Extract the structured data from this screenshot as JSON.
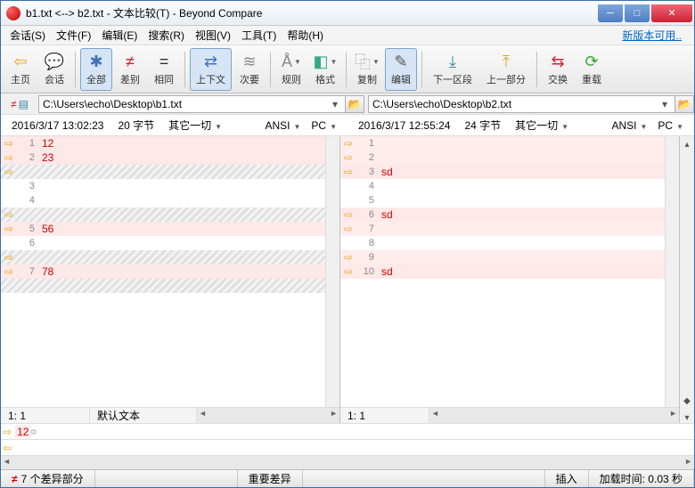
{
  "title": "b1.txt <--> b2.txt - 文本比较(T) - Beyond Compare",
  "menus": [
    "会话(S)",
    "文件(F)",
    "编辑(E)",
    "搜索(R)",
    "视图(V)",
    "工具(T)",
    "帮助(H)"
  ],
  "newVersion": "新版本可用..",
  "toolbar": [
    {
      "icon": "⇦",
      "label": "主页",
      "color": "#e6a817"
    },
    {
      "icon": "💬",
      "label": "会话",
      "color": "#c79a3a"
    },
    {
      "sep": true
    },
    {
      "icon": "✱",
      "label": "全部",
      "sel": true,
      "color": "#4073b8"
    },
    {
      "icon": "≠",
      "label": "差别",
      "color": "#c23"
    },
    {
      "icon": "=",
      "label": "相同",
      "color": "#333"
    },
    {
      "sep": true
    },
    {
      "icon": "⇄",
      "label": "上下文",
      "sel": true,
      "color": "#4073b8"
    },
    {
      "icon": "≋",
      "label": "次要",
      "color": "#888"
    },
    {
      "sep": true
    },
    {
      "icon": "Å",
      "label": "规则",
      "dd": true,
      "color": "#888"
    },
    {
      "icon": "◧",
      "label": "格式",
      "dd": true,
      "color": "#3a8"
    },
    {
      "sep": true
    },
    {
      "icon": "⿻",
      "label": "复制",
      "dd": true,
      "color": "#888"
    },
    {
      "icon": "✎",
      "label": "编辑",
      "sel": true,
      "color": "#555"
    },
    {
      "sep": true
    },
    {
      "icon": "⤓",
      "label": "下一区段",
      "color": "#38a"
    },
    {
      "icon": "⤒",
      "label": "上一部分",
      "color": "#ca3"
    },
    {
      "sep": true
    },
    {
      "icon": "⇆",
      "label": "交换",
      "color": "#c23"
    },
    {
      "icon": "⟳",
      "label": "重载",
      "color": "#3a3"
    }
  ],
  "left": {
    "path": "C:\\Users\\echo\\Desktop\\b1.txt",
    "timestamp": "2016/3/17 13:02:23",
    "size": "20 字节",
    "filter": "其它一切",
    "encoding": "ANSI",
    "platform": "PC",
    "pos": "1: 1",
    "mode": "默认文本",
    "mini": "12",
    "mini_suffix": "¤",
    "lines": [
      {
        "n": 1,
        "t": "12",
        "cls": "diff",
        "arr": true
      },
      {
        "n": 2,
        "t": "23",
        "cls": "diff",
        "arr": true
      },
      {
        "n": "",
        "t": "",
        "cls": "hatch",
        "arr": true
      },
      {
        "n": 3,
        "t": "",
        "cls": ""
      },
      {
        "n": 4,
        "t": "",
        "cls": ""
      },
      {
        "n": "",
        "t": "",
        "cls": "hatch",
        "arr": true
      },
      {
        "n": 5,
        "t": "56",
        "cls": "diff",
        "arr": true
      },
      {
        "n": 6,
        "t": "",
        "cls": ""
      },
      {
        "n": "",
        "t": "",
        "cls": "hatch",
        "arr": true
      },
      {
        "n": 7,
        "t": "78",
        "cls": "diff",
        "arr": true
      },
      {
        "n": "",
        "t": "",
        "cls": "hatch"
      }
    ]
  },
  "right": {
    "path": "C:\\Users\\echo\\Desktop\\b2.txt",
    "timestamp": "2016/3/17 12:55:24",
    "size": "24 字节",
    "filter": "其它一切",
    "encoding": "ANSI",
    "platform": "PC",
    "pos": "1: 1",
    "lines": [
      {
        "n": 1,
        "t": "",
        "cls": "pink",
        "arr": true
      },
      {
        "n": 2,
        "t": "",
        "cls": "pink",
        "arr": true
      },
      {
        "n": 3,
        "t": "sd",
        "cls": "diff",
        "arr": true
      },
      {
        "n": 4,
        "t": "",
        "cls": ""
      },
      {
        "n": 5,
        "t": "",
        "cls": ""
      },
      {
        "n": 6,
        "t": "sd",
        "cls": "diff",
        "arr": true
      },
      {
        "n": 7,
        "t": "",
        "cls": "pink",
        "arr": true
      },
      {
        "n": 8,
        "t": "",
        "cls": ""
      },
      {
        "n": 9,
        "t": "",
        "cls": "pink",
        "arr": true
      },
      {
        "n": 10,
        "t": "sd",
        "cls": "diff",
        "arr": true
      }
    ]
  },
  "footer": {
    "diffCount": "7 个差异部分",
    "importantDiff": "重要差异",
    "insert": "插入",
    "loadTime": "加载时间: 0.03 秒"
  }
}
